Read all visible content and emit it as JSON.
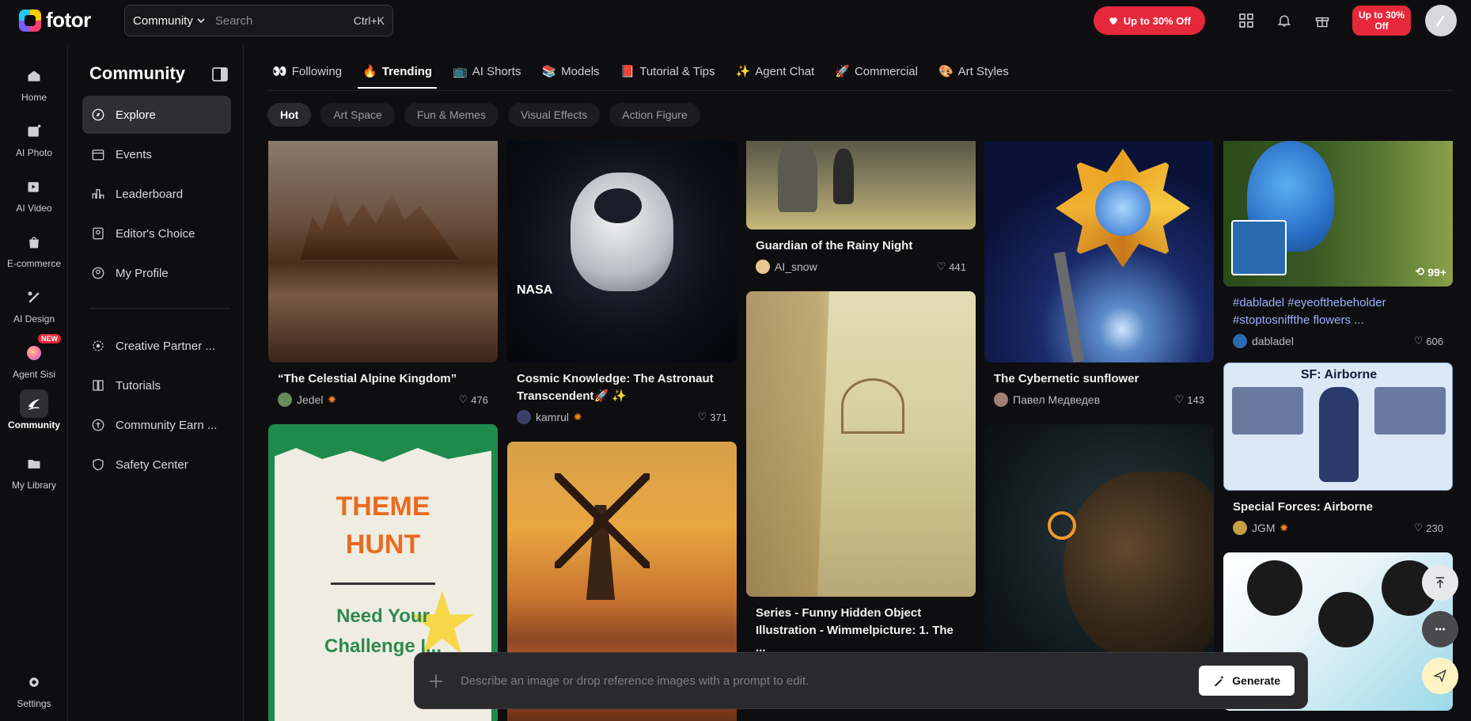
{
  "topbar": {
    "logo_text": "fotor",
    "search_scope": "Community",
    "search_placeholder": "Search",
    "search_shortcut": "Ctrl+K",
    "promo_pill": "Up to 30% Off",
    "promo_square": "Up to 30% Off"
  },
  "rail": [
    {
      "label": "Home",
      "icon": "home-icon"
    },
    {
      "label": "AI Photo",
      "icon": "ai-photo-icon"
    },
    {
      "label": "AI Video",
      "icon": "ai-video-icon"
    },
    {
      "label": "E-commerce",
      "icon": "shopping-bag-icon"
    },
    {
      "label": "AI Design",
      "icon": "ai-design-icon"
    },
    {
      "label": "Agent Sisi",
      "icon": "agent-icon",
      "badge": "NEW"
    },
    {
      "label": "Community",
      "icon": "community-icon",
      "active": true
    },
    {
      "label": "My Library",
      "icon": "folder-icon"
    },
    {
      "label": "Settings",
      "icon": "gear-icon"
    }
  ],
  "sidebar": {
    "title": "Community",
    "items": [
      {
        "label": "Explore",
        "active": true
      },
      {
        "label": "Events"
      },
      {
        "label": "Leaderboard"
      },
      {
        "label": "Editor's Choice"
      },
      {
        "label": "My Profile"
      },
      {
        "label": "Creative Partner ..."
      },
      {
        "label": "Tutorials"
      },
      {
        "label": "Community Earn ..."
      },
      {
        "label": "Safety Center"
      }
    ]
  },
  "tabs": [
    {
      "label": "Following",
      "emoji": "👀"
    },
    {
      "label": "Trending",
      "emoji": "🔥",
      "active": true
    },
    {
      "label": "AI Shorts",
      "emoji": "📺"
    },
    {
      "label": "Models",
      "emoji": "📚"
    },
    {
      "label": "Tutorial & Tips",
      "emoji": "📕"
    },
    {
      "label": "Agent Chat",
      "emoji": "✨"
    },
    {
      "label": "Commercial",
      "emoji": "🚀"
    },
    {
      "label": "Art Styles",
      "emoji": "🎨"
    }
  ],
  "chips": [
    "Hot",
    "Art Space",
    "Fun & Memes",
    "Visual Effects",
    "Action Figure"
  ],
  "cards": {
    "c1": {
      "title": "“The Celestial Alpine Kingdom”",
      "author": "Jedel",
      "likes": "476"
    },
    "c1b": {
      "theme_line1": "THEME",
      "theme_line2": "HUNT",
      "need_line1": "Need Your",
      "need_line2": "Challenge I..."
    },
    "c2": {
      "title": "Cosmic Knowledge: The Astronaut Transcendent🚀 ✨",
      "author": "kamrul",
      "likes": "371",
      "img_text": "NASA"
    },
    "c3": {
      "title": "Guardian of the Rainy Night",
      "author": "AI_snow",
      "likes": "441"
    },
    "c3b": {
      "title": "Series -  Funny Hidden Object Illustration  - Wimmelpicture:  1. The ..."
    },
    "c4": {
      "title": "The Cybernetic sunflower",
      "author": "Павел Медведев",
      "likes": "143"
    },
    "c5": {
      "tags": "#dabladel #eyeofthebeholder #stoptosniffthe flowers ...",
      "author": "dabladel",
      "likes": "606",
      "count_badge": "99+"
    },
    "c5b": {
      "title": "Special Forces: Airborne",
      "author": "JGM",
      "likes": "230",
      "img_text": "SF: Airborne"
    }
  },
  "prompt": {
    "placeholder": "Describe an image or drop reference images with a prompt to edit.",
    "generate_label": "Generate"
  }
}
